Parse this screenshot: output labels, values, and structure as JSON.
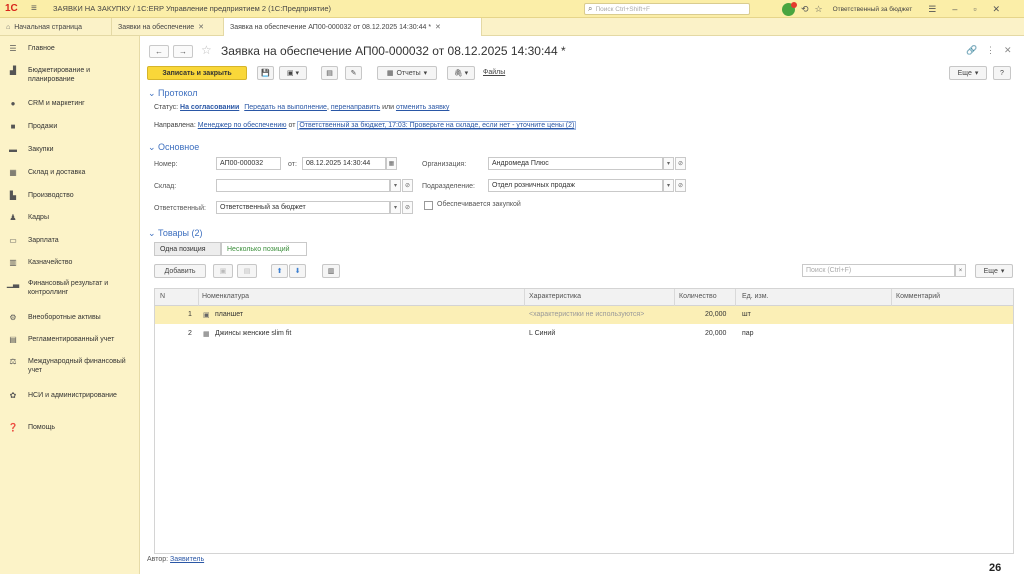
{
  "app": {
    "logo": "1С",
    "title": "ЗАЯВКИ НА ЗАКУПКУ / 1С:ERP Управление предприятием 2  (1С:Предприятие)",
    "search_placeholder": "Поиск Ctrl+Shift+F",
    "user": "Ответственный за бюджет"
  },
  "tabs": [
    {
      "label": "Начальная страница"
    },
    {
      "label": "Заявки на обеспечение"
    },
    {
      "label": "Заявка на обеспечение АП00-000032 от 08.12.2025 14:30:44 *"
    }
  ],
  "sidebar": {
    "items": [
      {
        "label": "Главное",
        "icon": "menu-icon"
      },
      {
        "label": "Бюджетирование и планирование",
        "icon": "chart-icon"
      },
      {
        "label": "CRM и маркетинг",
        "icon": "crm-icon"
      },
      {
        "label": "Продажи",
        "icon": "bag-icon"
      },
      {
        "label": "Закупки",
        "icon": "cart-icon"
      },
      {
        "label": "Склад и доставка",
        "icon": "warehouse-icon"
      },
      {
        "label": "Производство",
        "icon": "factory-icon"
      },
      {
        "label": "Кадры",
        "icon": "person-icon"
      },
      {
        "label": "Зарплата",
        "icon": "money-icon"
      },
      {
        "label": "Казначейство",
        "icon": "treasury-icon"
      },
      {
        "label": "Финансовый результат и контроллинг",
        "icon": "finance-icon"
      },
      {
        "label": "Внеоборотные активы",
        "icon": "assets-icon"
      },
      {
        "label": "Регламентированный учет",
        "icon": "ledger-icon"
      },
      {
        "label": "Международный финансовый учет",
        "icon": "intl-icon"
      },
      {
        "label": "НСИ и администрирование",
        "icon": "gear-icon"
      },
      {
        "label": "Помощь",
        "icon": "help-icon"
      }
    ]
  },
  "document": {
    "title": "Заявка на обеспечение АП00-000032 от 08.12.2025 14:30:44 *",
    "toolbar": {
      "save_close": "Записать и закрыть",
      "reports": "Отчеты",
      "files": "Файлы",
      "more": "Еще"
    },
    "protocol": {
      "section": "Протокол",
      "status_label": "Статус:",
      "status_value": "На согласовании",
      "action_transfer": "Передать на выполнение",
      "sep1": ",",
      "action_redirect": "перенаправить",
      "or_text": "или",
      "action_cancel": "отменить заявку",
      "directed_label": "Направлена:",
      "directed_to": "Менеджер по обеспечению",
      "from_text": "от",
      "directed_from": "Ответственный за бюджет, 17:03: Проверьте на складе, если нет - уточните цены (2)"
    },
    "main": {
      "section": "Основное",
      "number_label": "Номер:",
      "number_value": "АП00-000032",
      "date_label": "от:",
      "date_value": "08.12.2025 14:30:44",
      "org_label": "Организация:",
      "org_value": "Андромеда Плюс",
      "warehouse_label": "Склад:",
      "warehouse_value": "",
      "division_label": "Подразделение:",
      "division_value": "Отдел розничных продаж",
      "responsible_label": "Ответственный:",
      "responsible_value": "Ответственный за бюджет",
      "purchase_label": "Обеспечивается закупкой"
    },
    "goods": {
      "section": "Товары (2)",
      "mode_single": "Одна позиция",
      "mode_multi": "Несколько позиций",
      "add": "Добавить",
      "search_placeholder": "Поиск (Ctrl+F)",
      "more": "Еще",
      "columns": [
        "N",
        "Номенклатура",
        "Характеристика",
        "Количество",
        "Ед. изм.",
        "Комментарий"
      ],
      "rows": [
        {
          "n": "1",
          "name": "планшет",
          "characteristic": "<характеристики не используются>",
          "qty": "20,000",
          "unit": "шт",
          "comment": ""
        },
        {
          "n": "2",
          "name": "Джинсы женские slim fit",
          "characteristic": "L Синий",
          "qty": "20,000",
          "unit": "пар",
          "comment": ""
        }
      ]
    },
    "footer": {
      "author_label": "Автор:",
      "author_value": "Заявитель"
    }
  },
  "page_number": "26"
}
